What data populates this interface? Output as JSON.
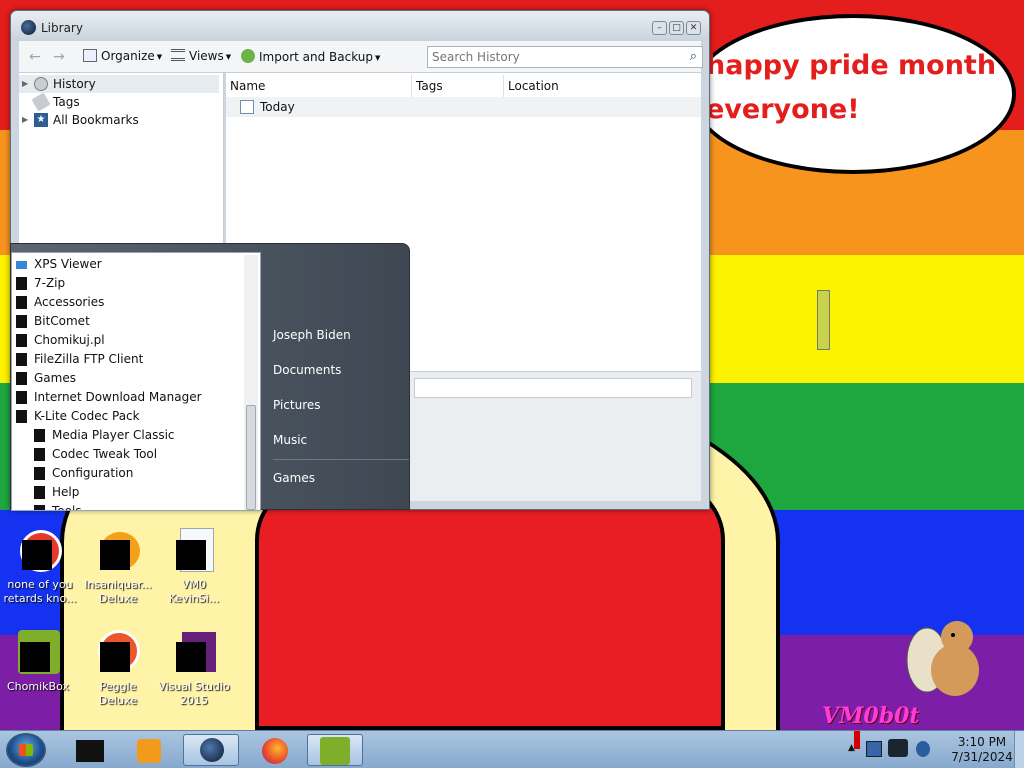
{
  "wallpaper": {
    "speech_text": "happy pride month\neveryone!",
    "watermark": "VM0b0t"
  },
  "desktop_icons": [
    {
      "label": "none of you retards kno..."
    },
    {
      "label": "Insaniquar... Deluxe"
    },
    {
      "label": "VM0 KevinSi..."
    },
    {
      "label": "ChomikBox"
    },
    {
      "label": "Peggle Deluxe"
    },
    {
      "label": "Visual Studio 2015"
    }
  ],
  "library": {
    "title": "Library",
    "toolbar": {
      "organize": "Organize",
      "views": "Views",
      "import_backup": "Import and Backup"
    },
    "search": {
      "placeholder": "Search History"
    },
    "tree": [
      {
        "label": "History",
        "icon": "clock-icon"
      },
      {
        "label": "Tags",
        "icon": "tag-icon"
      },
      {
        "label": "All Bookmarks",
        "icon": "star-icon"
      }
    ],
    "columns": [
      "Name",
      "Tags",
      "Location"
    ],
    "rows": [
      {
        "name": "Today"
      }
    ]
  },
  "start_menu": {
    "programs": [
      {
        "label": "XPS Viewer",
        "indent": 0
      },
      {
        "label": "7-Zip",
        "indent": 0
      },
      {
        "label": "Accessories",
        "indent": 0
      },
      {
        "label": "BitComet",
        "indent": 0
      },
      {
        "label": "Chomikuj.pl",
        "indent": 0
      },
      {
        "label": "FileZilla FTP Client",
        "indent": 0
      },
      {
        "label": "Games",
        "indent": 0
      },
      {
        "label": "Internet Download Manager",
        "indent": 0
      },
      {
        "label": "K-Lite Codec Pack",
        "indent": 0
      },
      {
        "label": "Media Player Classic",
        "indent": 1
      },
      {
        "label": "Codec Tweak Tool",
        "indent": 1
      },
      {
        "label": "Configuration",
        "indent": 1
      },
      {
        "label": "Help",
        "indent": 1
      },
      {
        "label": "Tools",
        "indent": 1
      }
    ],
    "right": {
      "user": "Joseph Biden",
      "documents": "Documents",
      "pictures": "Pictures",
      "music": "Music",
      "games": "Games"
    }
  },
  "taskbar": {
    "time": "3:10 PM",
    "date": "7/31/2024"
  },
  "colors": {
    "taskbar": "#9dbcdc",
    "speech_text": "#e41d1d"
  }
}
